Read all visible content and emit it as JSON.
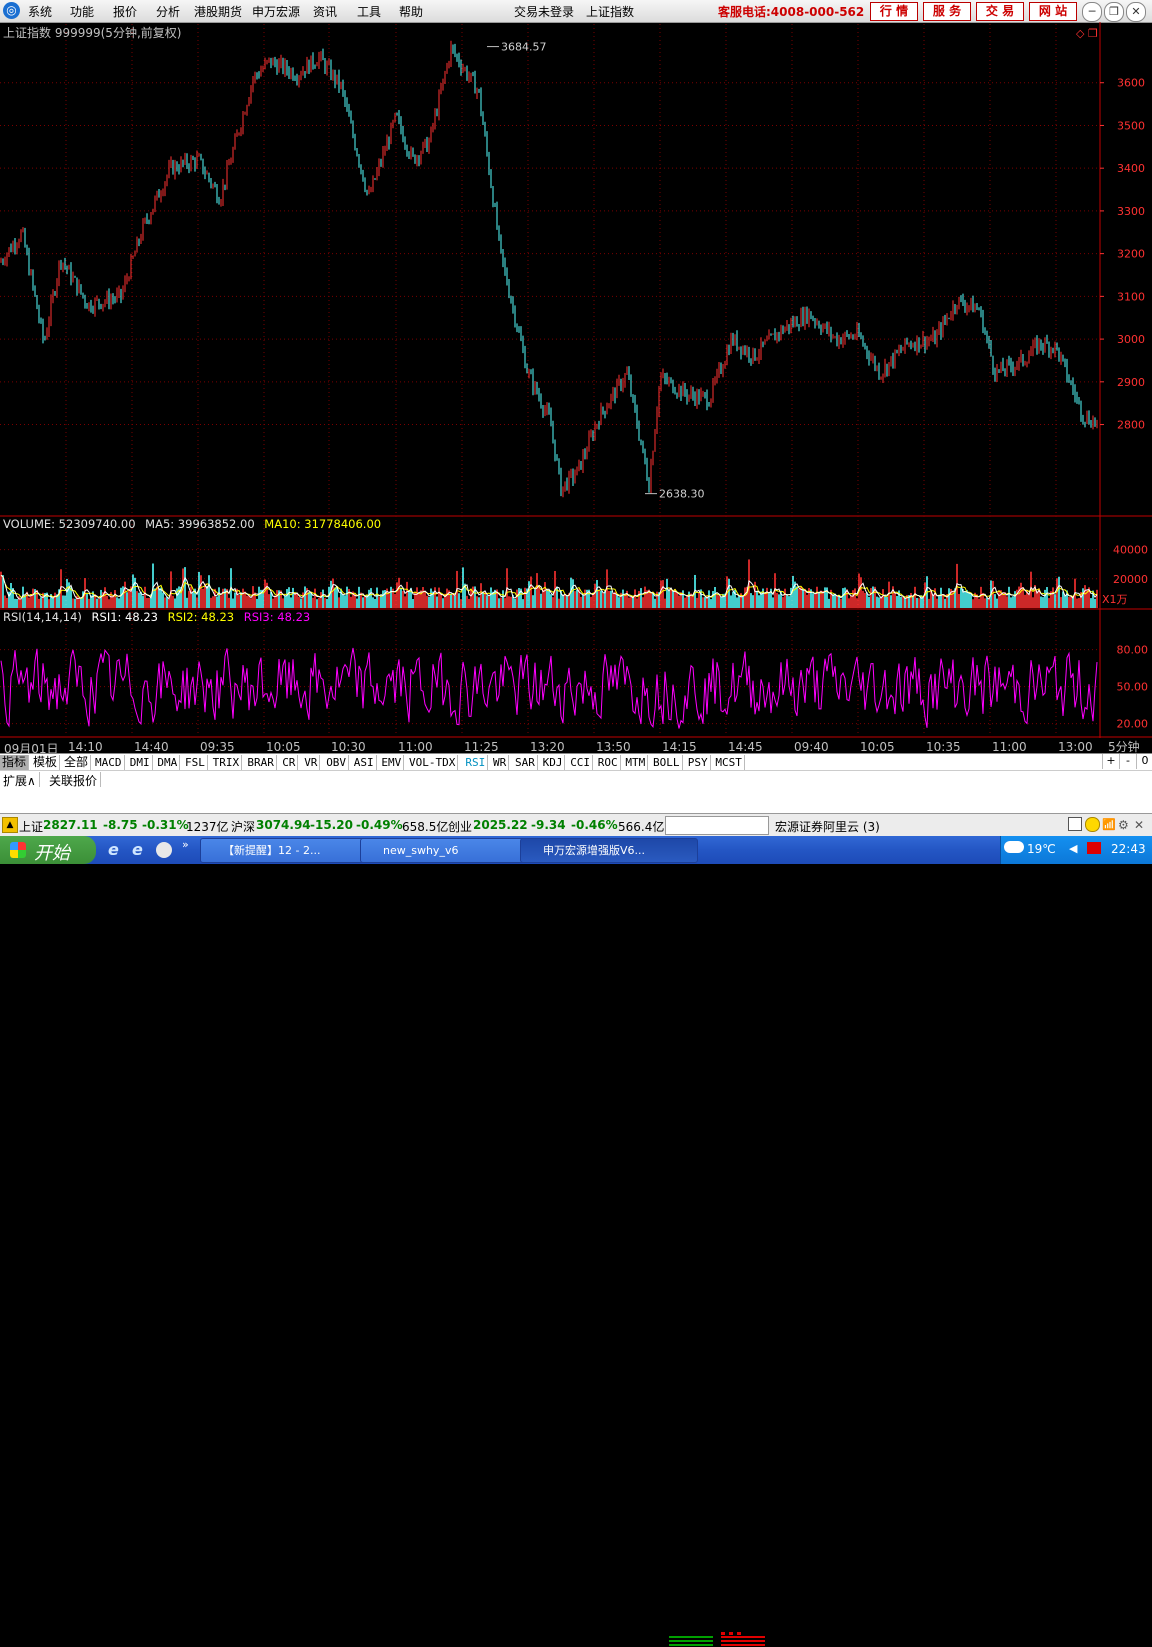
{
  "menu": {
    "logo": "◎",
    "items": [
      "系统",
      "功能",
      "报价",
      "分析",
      "港股期货",
      "申万宏源",
      "资讯",
      "工具",
      "帮助"
    ],
    "status_login": "交易未登录",
    "current_index": "上证指数",
    "hotline": "客服电话:4008-000-562",
    "buttons": [
      "行 情",
      "服 务",
      "交 易",
      "网 站"
    ]
  },
  "chart_header": {
    "title": "上证指数 999999(5分钟,前复权)"
  },
  "volume_header": {
    "volume": "VOLUME: 52309740.00",
    "ma5": "MA5: 39963852.00",
    "ma10": "MA10: 31778406.00"
  },
  "rsi_header": {
    "params": "RSI(14,14,14)",
    "rsi1": "RSI1: 48.23",
    "rsi2": "RSI2: 48.23",
    "rsi3": "RSI3: 48.23"
  },
  "volume_unit": "X1万",
  "period_label": "5分钟",
  "scroll": {
    "plus": "+",
    "minus": "-",
    "zero": "0"
  },
  "indicator_tabs": [
    "指标",
    "模板",
    "全部",
    "MACD",
    "DMI",
    "DMA",
    "FSL",
    "TRIX",
    "BRAR",
    "CR",
    "VR",
    "OBV",
    "ASI",
    "EMV",
    "VOL-TDX",
    "RSI",
    "WR",
    "SAR",
    "KDJ",
    "CCI",
    "ROC",
    "MTM",
    "BOLL",
    "PSY",
    "MCST"
  ],
  "sub_tabs": [
    "扩展∧",
    "关联报价"
  ],
  "status_bar": {
    "sh_label": "上证",
    "sh_value": "2827.11",
    "sh_change": "-8.75",
    "sh_pct": "-0.31%",
    "sh_amount": "1237亿",
    "hs_label": "沪深",
    "hs_value": "3074.94",
    "hs_change": "-15.20",
    "hs_pct": "-0.49%",
    "hs_amount": "658.5亿",
    "cy_label": "创业",
    "cy_value": "2025.22",
    "cy_change": "-9.34",
    "cy_pct": "-0.46%",
    "cy_amount": "566.4亿",
    "server": "宏源证券阿里云 (3)"
  },
  "taskbar": {
    "start": "开始",
    "tasks": [
      "【新提醒】12 - 2...",
      "new_swhy_v6",
      "申万宏源增强版V6..."
    ],
    "temperature": "19℃",
    "time": "22:43"
  },
  "colors": {
    "up": "#ff3232",
    "down": "#54ffff",
    "grid": "#7a0000",
    "axis": "#ff3232",
    "ma5": "#ffffff",
    "ma10": "#ffff00",
    "rsi": "#ff00ff"
  },
  "chart_data": [
    {
      "type": "line",
      "name": "price",
      "y_ticks": [
        2800,
        2900,
        3000,
        3100,
        3200,
        3300,
        3400,
        3500,
        3600
      ],
      "ylim": [
        2600,
        3700
      ],
      "annotations": [
        {
          "label": "3684.57",
          "value": 3684.57
        },
        {
          "label": "2638.30",
          "value": 2638.3
        }
      ],
      "x_tick_labels": [
        "09月01日",
        "14:10",
        "14:40",
        "09:35",
        "10:05",
        "10:30",
        "11:00",
        "11:25",
        "13:20",
        "13:50",
        "14:15",
        "14:45",
        "09:40",
        "10:05",
        "10:35",
        "11:00",
        "13:00"
      ],
      "x": [
        0,
        0.02,
        0.04,
        0.055,
        0.08,
        0.11,
        0.13,
        0.155,
        0.18,
        0.2,
        0.23,
        0.245,
        0.27,
        0.29,
        0.31,
        0.335,
        0.36,
        0.375,
        0.39,
        0.41,
        0.435,
        0.455,
        0.48,
        0.5,
        0.51,
        0.525,
        0.545,
        0.57,
        0.59,
        0.6,
        0.625,
        0.645,
        0.665,
        0.685,
        0.71,
        0.735,
        0.76,
        0.78,
        0.8,
        0.825,
        0.85,
        0.87,
        0.89,
        0.905,
        0.93,
        0.945,
        0.96,
        0.985,
        1.0
      ],
      "values": [
        3180,
        3250,
        2990,
        3190,
        3080,
        3100,
        3260,
        3400,
        3420,
        3330,
        3610,
        3650,
        3620,
        3660,
        3590,
        3330,
        3520,
        3420,
        3460,
        3680,
        3580,
        3200,
        2920,
        2810,
        2650,
        2690,
        2820,
        2920,
        2660,
        2910,
        2870,
        2860,
        3000,
        2960,
        3020,
        3060,
        3000,
        3010,
        2920,
        2990,
        3000,
        3090,
        3070,
        2920,
        2950,
        2990,
        2980,
        2820,
        2800
      ]
    },
    {
      "type": "bar",
      "name": "volume",
      "y_ticks": [
        20000,
        40000
      ],
      "ylim": [
        0,
        50000
      ],
      "series": [
        {
          "name": "MA5",
          "color": "#ffffff"
        },
        {
          "name": "MA10",
          "color": "#ffff00"
        }
      ]
    },
    {
      "type": "line",
      "name": "rsi",
      "y_ticks": [
        20,
        50,
        80
      ],
      "ylim": [
        10,
        100
      ]
    }
  ]
}
